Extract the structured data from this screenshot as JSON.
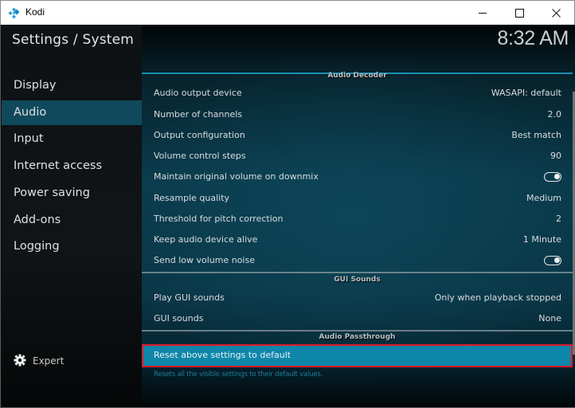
{
  "window": {
    "title": "Kodi",
    "icon": "kodi-logo-icon",
    "controls": {
      "minimize": "minimize-icon",
      "maximize": "maximize-icon",
      "close": "close-icon"
    }
  },
  "header": {
    "title": "Settings / System",
    "clock": "8:32 AM"
  },
  "sidebar": {
    "items": [
      {
        "label": "Display",
        "active": false
      },
      {
        "label": "Audio",
        "active": true
      },
      {
        "label": "Input",
        "active": false
      },
      {
        "label": "Internet access",
        "active": false
      },
      {
        "label": "Power saving",
        "active": false
      },
      {
        "label": "Add-ons",
        "active": false
      },
      {
        "label": "Logging",
        "active": false
      }
    ],
    "level": {
      "label": "Expert",
      "icon": "gear-icon"
    }
  },
  "sections": [
    {
      "title": "Audio Decoder",
      "rows": [
        {
          "label": "Audio output device",
          "value": "WASAPI: default"
        },
        {
          "label": "Number of channels",
          "value": "2.0"
        },
        {
          "label": "Output configuration",
          "value": "Best match"
        },
        {
          "label": "Volume control steps",
          "value": "90"
        },
        {
          "label": "Maintain original volume on downmix",
          "toggle": true
        },
        {
          "label": "Resample quality",
          "value": "Medium"
        },
        {
          "label": "Threshold for pitch correction",
          "value": "2"
        },
        {
          "label": "Keep audio device alive",
          "value": "1 Minute"
        },
        {
          "label": "Send low volume noise",
          "toggle": true
        }
      ]
    },
    {
      "title": "GUI Sounds",
      "rows": [
        {
          "label": "Play GUI sounds",
          "value": "Only when playback stopped"
        },
        {
          "label": "GUI sounds",
          "value": "None"
        }
      ]
    },
    {
      "title": "Audio Passthrough",
      "rows": []
    }
  ],
  "reset": {
    "label": "Reset above settings to default",
    "description": "Resets all the visible settings to their default values."
  },
  "colors": {
    "accent": "#0e86a9",
    "sidebar_active": "#10495c",
    "highlight_border": "#e01a2a"
  }
}
